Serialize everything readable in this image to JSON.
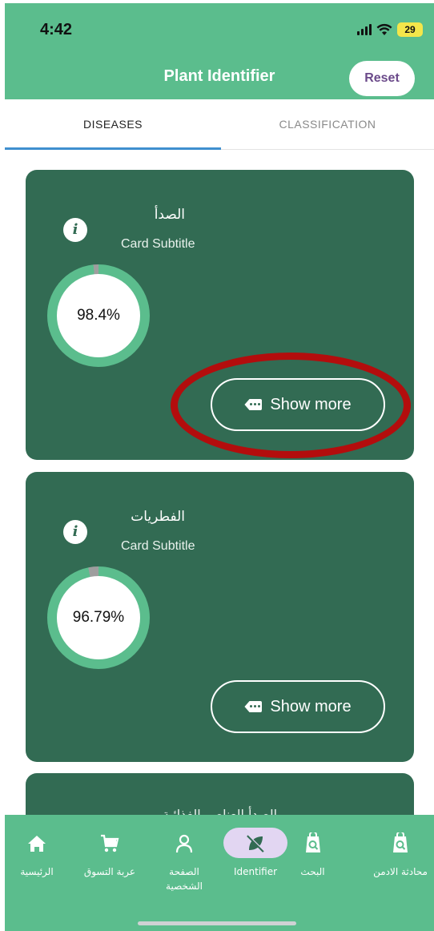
{
  "status_bar": {
    "time": "4:42",
    "battery": "29"
  },
  "header": {
    "title": "Plant Identifier",
    "reset_label": "Reset"
  },
  "tabs": [
    {
      "label": "DISEASES",
      "selected": true
    },
    {
      "label": "CLASSIFICATION",
      "selected": false
    }
  ],
  "cards": [
    {
      "title": "الصدأ",
      "subtitle": "Card Subtitle",
      "percent_label": "98.4%",
      "progress": 0.984,
      "button_label": "Show more"
    },
    {
      "title": "الفطريات",
      "subtitle": "Card Subtitle",
      "percent_label": "96.79%",
      "progress": 0.9679,
      "button_label": "Show more"
    }
  ],
  "partial_card": {
    "title": "الصدأ العناصر الغذائية"
  },
  "bottom_nav": [
    {
      "label": "محادثة الادمن",
      "icon": "search-bag-icon"
    },
    {
      "label": "البحث",
      "icon": "search-bag-icon"
    },
    {
      "label": "Identifier",
      "icon": "no-plant-icon",
      "selected": true
    },
    {
      "label": "الصفحة الشخصية",
      "icon": "person-icon"
    },
    {
      "label": "عربة التسوق",
      "icon": "cart-icon"
    },
    {
      "label": "الرئيسية",
      "icon": "home-icon"
    }
  ],
  "colors": {
    "header": "#5bbd8d",
    "card": "#326b53",
    "tab_indicator": "#3f8fcf",
    "progress_ring": "#5bbd8d",
    "progress_track": "#9e9e9e",
    "annotation": "#b30d0d",
    "nav_pill": "#e2d6f2"
  }
}
